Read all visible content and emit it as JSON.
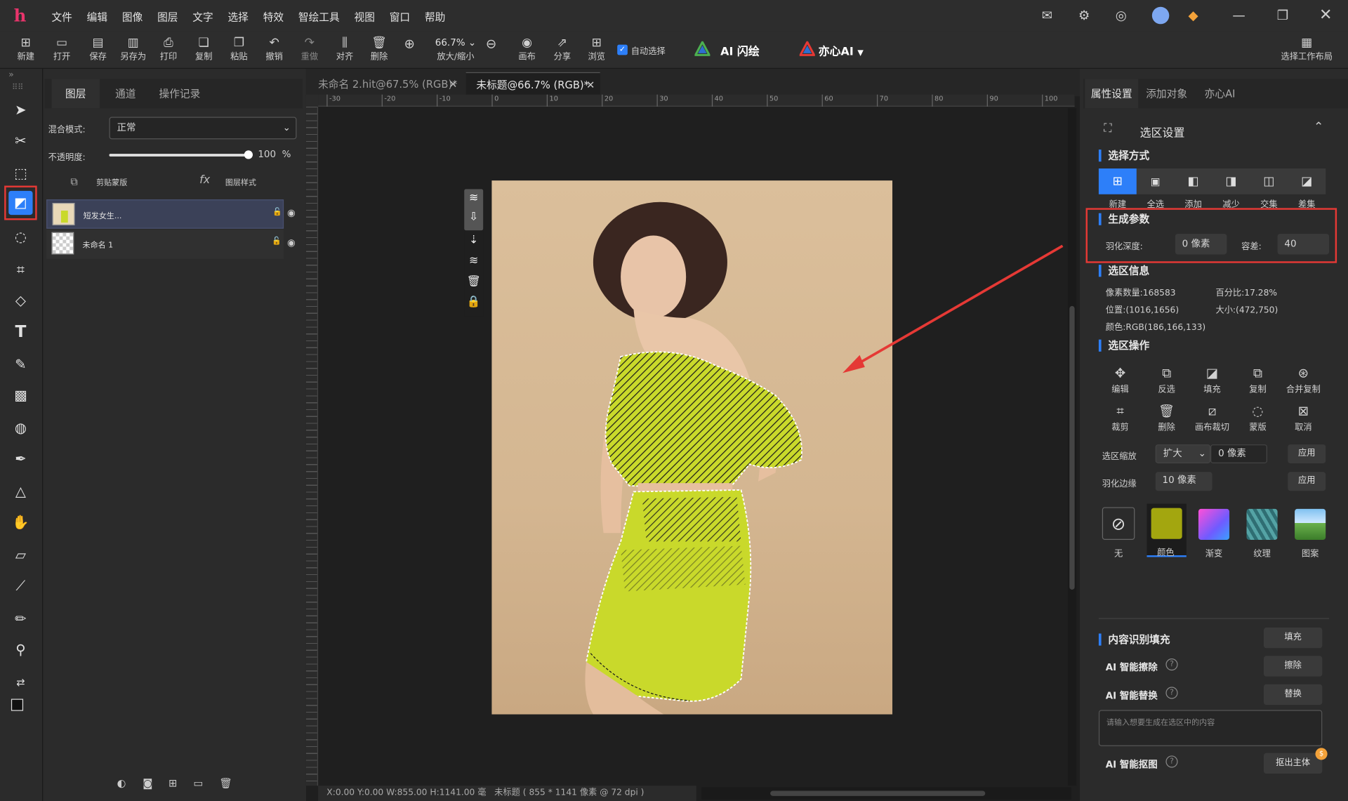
{
  "menu": [
    "文件",
    "编辑",
    "图像",
    "图层",
    "文字",
    "选择",
    "特效",
    "智绘工具",
    "视图",
    "窗口",
    "帮助"
  ],
  "window_icons": [
    "mail-icon",
    "settings-icon",
    "compass-icon",
    "avatar",
    "gem-icon",
    "minimize-icon",
    "restore-icon",
    "close-icon"
  ],
  "toolbar": {
    "new": "新建",
    "open": "打开",
    "save": "保存",
    "save_as": "另存为",
    "print": "打印",
    "copy": "复制",
    "paste": "粘贴",
    "undo": "撤销",
    "redo": "重做",
    "align": "对齐",
    "delete": "删除",
    "zoom_value": "66.7%",
    "zoom_label": "放大/缩小",
    "canvas": "画布",
    "share": "分享",
    "browse": "浏览",
    "auto_select": "自动选择",
    "ai_flash": "AI 闪绘",
    "yixin_ai": "亦心AI",
    "workspace": "选择工作布局"
  },
  "layers_panel": {
    "tabs": [
      "图层",
      "通道",
      "操作记录"
    ],
    "blend_label": "混合模式:",
    "blend_value": "正常",
    "opacity_label": "不透明度:",
    "opacity_value": "100",
    "opacity_unit": "%",
    "opacity_fraction": 1.0,
    "clip_mask": "剪贴蒙版",
    "layer_style": "图层样式",
    "layers": [
      {
        "name": "短发女生..."
      },
      {
        "name": "未命名 1"
      }
    ]
  },
  "doc_tabs": [
    {
      "title": "未命名 2.hit@67.5% (RGB)*",
      "active": false
    },
    {
      "title": "未标题@66.7% (RGB)*",
      "active": true
    }
  ],
  "ruler_top": [
    "-30",
    "-20",
    "-10",
    "0",
    "10",
    "20",
    "30",
    "40",
    "50",
    "60",
    "70",
    "80",
    "90",
    "100"
  ],
  "status": {
    "coords": "X:0.00 Y:0.00 W:855.00 H:1141.00 毫",
    "doc": "未标题 ( 855 * 1141 像素 @ 72 dpi )"
  },
  "right_panel": {
    "tabs": [
      "属性设置",
      "添加对象",
      "亦心AI"
    ],
    "section_title": "选区设置",
    "select_mode": {
      "title": "选择方式",
      "items": [
        "新建",
        "全选",
        "添加",
        "减少",
        "交集",
        "差集"
      ]
    },
    "gen_params": {
      "title": "生成参数",
      "feather_label": "羽化深度:",
      "feather_value": "0 像素",
      "tolerance_label": "容差:",
      "tolerance_value": "40"
    },
    "info": {
      "title": "选区信息",
      "pixels": "像素数量:168583",
      "percent": "百分比:17.28%",
      "position": "位置:(1016,1656)",
      "size": "大小:(472,750)",
      "color": "颜色:RGB(186,166,133)"
    },
    "ops": {
      "title": "选区操作",
      "row1": [
        "编辑",
        "反选",
        "填充",
        "复制",
        "合并复制"
      ],
      "row2": [
        "裁剪",
        "删除",
        "画布裁切",
        "蒙版",
        "取消"
      ]
    },
    "scale": {
      "label": "选区缩放",
      "mode": "扩大",
      "value": "0 像素",
      "apply": "应用"
    },
    "feather_edge": {
      "label": "羽化边缘",
      "value": "10 像素",
      "apply": "应用"
    },
    "fills": [
      "无",
      "颜色",
      "渐变",
      "纹理",
      "图案"
    ],
    "content_fill": {
      "title": "内容识别填充",
      "button": "填充"
    },
    "ai_erase": {
      "title": "AI 智能擦除",
      "button": "擦除"
    },
    "ai_replace": {
      "title": "AI 智能替换",
      "button": "替换"
    },
    "prompt_placeholder": "请输入想要生成在选区中的内容",
    "ai_cutout": {
      "title": "AI 智能抠图",
      "button": "抠出主体"
    }
  },
  "colors": {
    "accent": "#2d7ff9",
    "highlight_box": "#e53935",
    "selection_fill": "#c9d92b"
  }
}
